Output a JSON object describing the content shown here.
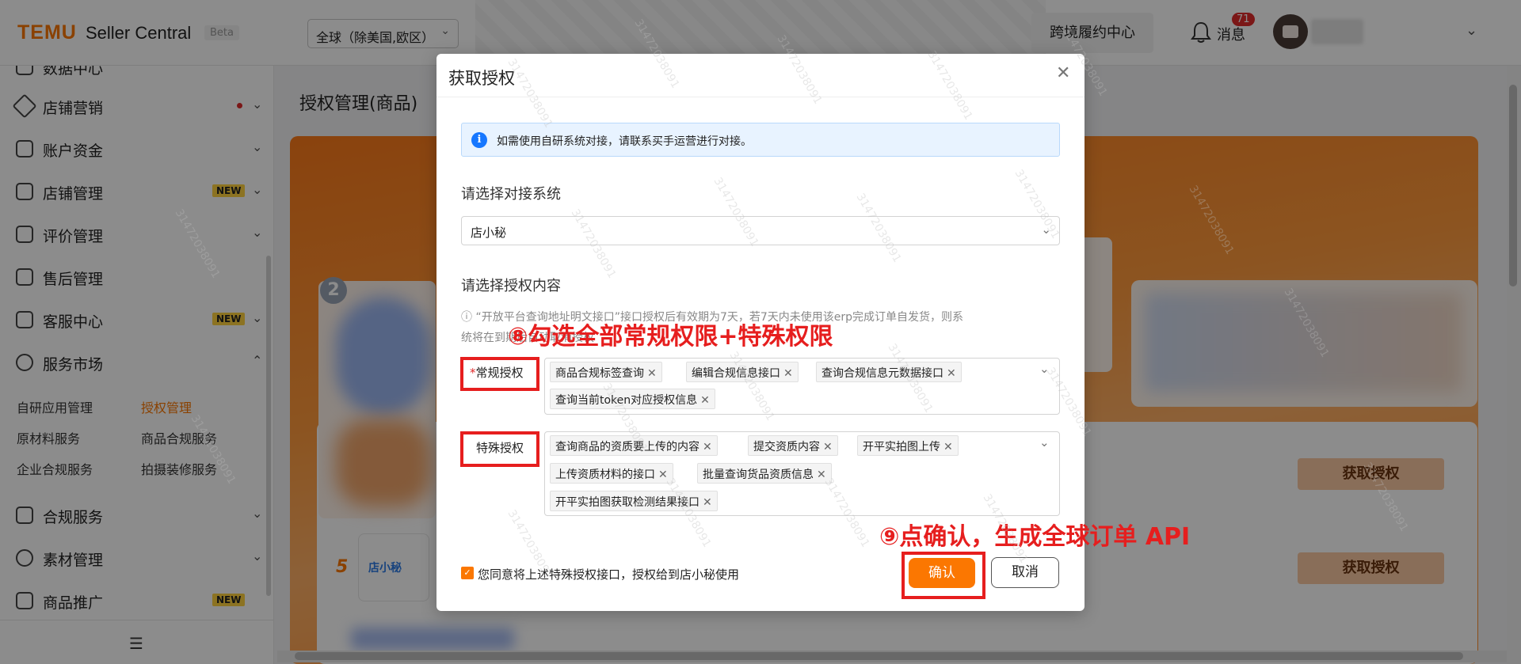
{
  "topbar": {
    "logo": "TEMU",
    "logo_sub": "Seller Central",
    "beta": "Beta",
    "region": "全球（除美国,欧区）",
    "fulfillment": "跨境履约中心",
    "messages_label": "消息",
    "messages_count": "71"
  },
  "sidebar": {
    "items": [
      {
        "label": "数据中心"
      },
      {
        "label": "店铺营销"
      },
      {
        "label": "账户资金"
      },
      {
        "label": "店铺管理",
        "badge": "NEW"
      },
      {
        "label": "评价管理"
      },
      {
        "label": "售后管理"
      },
      {
        "label": "客服中心",
        "badge": "NEW"
      },
      {
        "label": "服务市场"
      },
      {
        "label": "合规服务"
      },
      {
        "label": "素材管理"
      },
      {
        "label": "商品推广",
        "badge": "NEW"
      }
    ],
    "subitems": [
      "自研应用管理",
      "授权管理",
      "原材料服务",
      "商品合规服务",
      "企业合规服务",
      "拍摄装修服务"
    ]
  },
  "main": {
    "page_title": "授权管理(商品)",
    "card_number": "2",
    "row_number": "5",
    "dxm_logo_text": "店小秘",
    "get_auth_labels": [
      "获取授权",
      "获取授权"
    ]
  },
  "modal": {
    "title": "获取授权",
    "info": "如需使用自研系统对接，请联系买手运营进行对接。",
    "system_label": "请选择对接系统",
    "system_value": "店小秘",
    "content_label": "请选择授权内容",
    "hint_line1": "ⓘ “开放平台查询地址明文接口”接口授权后有效期为7天，若7天内未使用该erp完成订单自发货，则系",
    "hint_line2": "统将在到期后自动取消授权",
    "regular_label": "常规授权",
    "regular_required": "*",
    "regular_tags": [
      "商品合规标签查询",
      "编辑合规信息接口",
      "查询合规信息元数据接口",
      "查询当前token对应授权信息"
    ],
    "special_label": "特殊授权",
    "special_tags": [
      "查询商品的资质要上传的内容",
      "提交资质内容",
      "开平实拍图上传",
      "上传资质材料的接口",
      "批量查询货品资质信息",
      "开平实拍图获取检测结果接口"
    ],
    "agree_text": "您同意将上述特殊授权接口，授权给到店小秘使用",
    "confirm": "确认",
    "cancel": "取消"
  },
  "annotations": {
    "step8": "⑧勾选全部常规权限+特殊权限",
    "step9": "⑨点确认，生成全球订单 API"
  },
  "watermark": "3147203809​1",
  "colors": {
    "brand": "#fb7701",
    "annotation": "#e61e1e",
    "info_blue": "#1677ff"
  }
}
